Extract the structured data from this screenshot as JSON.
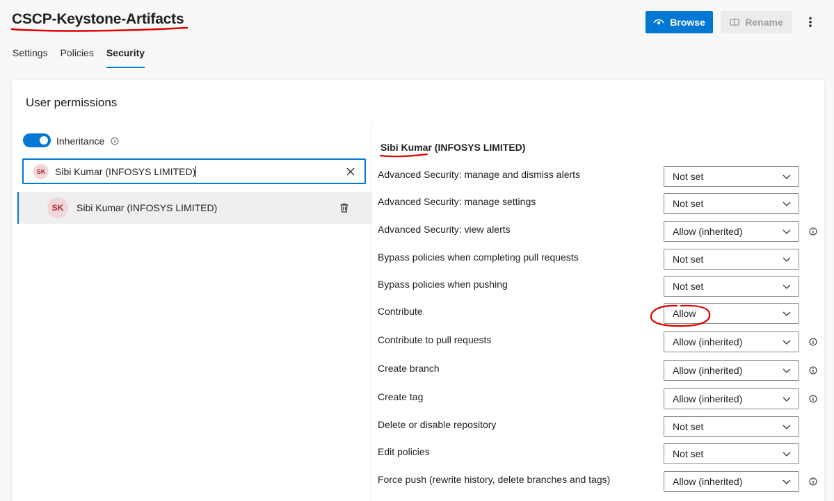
{
  "header": {
    "title": "CSCP-Keystone-Artifacts",
    "browse_label": "Browse",
    "rename_label": "Rename",
    "more_glyph": "⋮",
    "accent_color": "#0078d4",
    "annotation_color": "#e00000"
  },
  "tabs": [
    {
      "label": "Settings",
      "active": false
    },
    {
      "label": "Policies",
      "active": false
    },
    {
      "label": "Security",
      "active": true
    }
  ],
  "card": {
    "title": "User permissions",
    "inheritance_label": "Inheritance",
    "inheritance_on": true,
    "search_value": "Sibi Kumar (INFOSYS LIMITED)",
    "search_avatar": "SK",
    "selected_user": {
      "initials": "SK",
      "name": "Sibi Kumar (INFOSYS LIMITED)"
    }
  },
  "permissions": {
    "header": "Sibi Kumar (INFOSYS LIMITED)",
    "rows": [
      {
        "label": "Advanced Security: manage and dismiss alerts",
        "value": "Not set",
        "info": false
      },
      {
        "label": "Advanced Security: manage settings",
        "value": "Not set",
        "info": false
      },
      {
        "label": "Advanced Security: view alerts",
        "value": "Allow (inherited)",
        "info": true
      },
      {
        "label": "Bypass policies when completing pull requests",
        "value": "Not set",
        "info": false
      },
      {
        "label": "Bypass policies when pushing",
        "value": "Not set",
        "info": false
      },
      {
        "label": "Contribute",
        "value": "Allow",
        "info": false
      },
      {
        "label": "Contribute to pull requests",
        "value": "Allow (inherited)",
        "info": true
      },
      {
        "label": "Create branch",
        "value": "Allow (inherited)",
        "info": true
      },
      {
        "label": "Create tag",
        "value": "Allow (inherited)",
        "info": true
      },
      {
        "label": "Delete or disable repository",
        "value": "Not set",
        "info": false
      },
      {
        "label": "Edit policies",
        "value": "Not set",
        "info": false
      },
      {
        "label": "Force push (rewrite history, delete branches and tags)",
        "value": "Allow (inherited)",
        "info": true
      }
    ]
  }
}
